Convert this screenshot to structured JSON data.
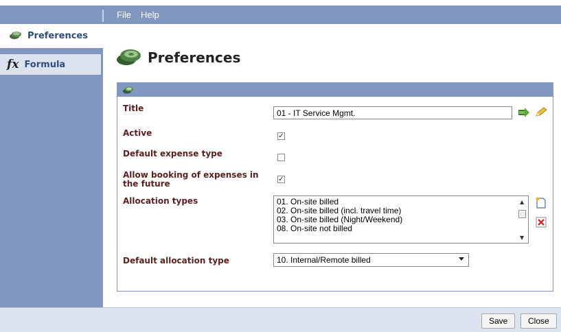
{
  "menu": {
    "file": "File",
    "help": "Help"
  },
  "sidebar": {
    "items": [
      {
        "label": "Preferences",
        "icon": "money-icon"
      },
      {
        "label": "Formula",
        "icon": "formula-icon"
      }
    ]
  },
  "page": {
    "title": "Preferences"
  },
  "form": {
    "title_label": "Title",
    "title_value": "01 - IT Service Mgmt.",
    "active_label": "Active",
    "active_checked": true,
    "default_expense_label": "Default expense type",
    "default_expense_checked": false,
    "allow_booking_label": "Allow booking of expenses in the future",
    "allow_booking_checked": true,
    "allocation_types_label": "Allocation types",
    "allocation_types": [
      "01. On-site billed",
      "02. On-site billed (incl. travel time)",
      "03. On-site billed (Night/Weekend)",
      "08. On-site not billed"
    ],
    "default_allocation_label": "Default allocation type",
    "default_allocation_value": "10. Internal/Remote billed"
  },
  "footer": {
    "save": "Save",
    "close": "Close"
  }
}
